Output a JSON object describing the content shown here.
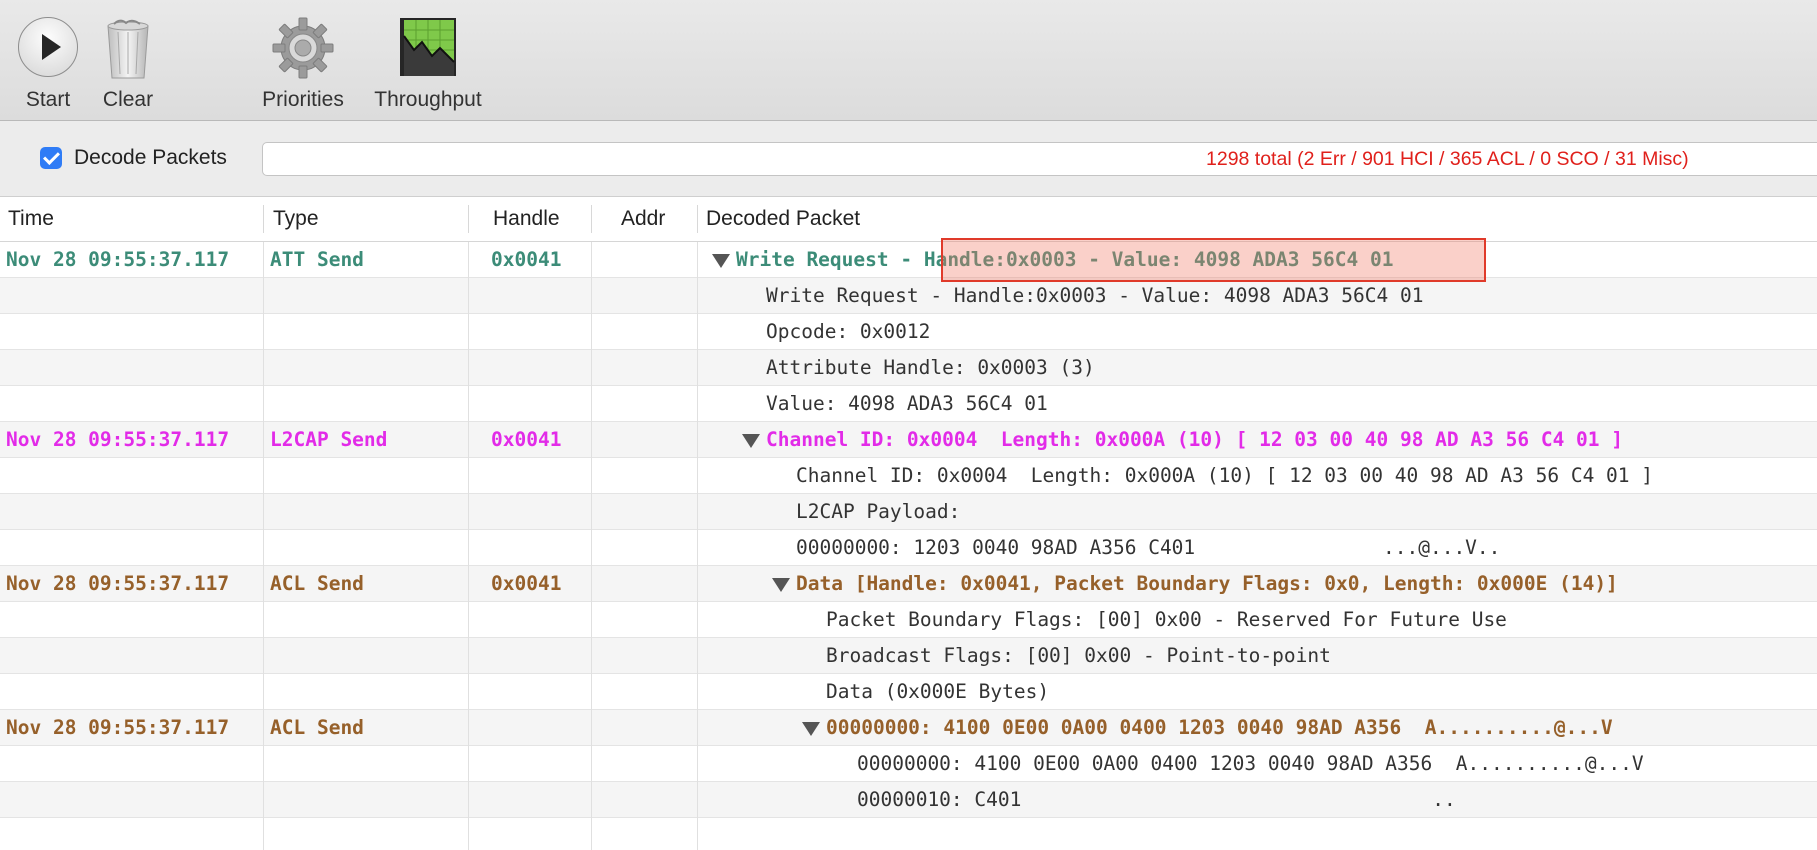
{
  "toolbar": {
    "start_label": "Start",
    "clear_label": "Clear",
    "priorities_label": "Priorities",
    "throughput_label": "Throughput"
  },
  "filter": {
    "decode_label": "Decode Packets",
    "decode_checked": true,
    "stats": "1298 total (2 Err / 901 HCI / 365 ACL / 0 SCO / 31 Misc)"
  },
  "columns": [
    "Time",
    "Type",
    "Handle",
    "Addr",
    "Decoded Packet"
  ],
  "colors": {
    "att": "#3c8c78",
    "l2cap": "#e22be8",
    "acl": "#96602a",
    "detail": "#333333",
    "highlight_border": "#e03a2a"
  },
  "rows": [
    {
      "time": "Nov 28 09:55:37.117",
      "type": "ATT Send",
      "handle": "0x0041",
      "addr": "",
      "packet": "Write Request - Handle:0x0003 - Value: 4098 ADA3 56C4 01",
      "kind": "att",
      "expandable": true
    },
    {
      "time": "",
      "type": "",
      "handle": "",
      "addr": "",
      "packet": "Write Request - Handle:0x0003 - Value: 4098 ADA3 56C4 01",
      "kind": "detail"
    },
    {
      "time": "",
      "type": "",
      "handle": "",
      "addr": "",
      "packet": "Opcode: 0x0012",
      "kind": "detail"
    },
    {
      "time": "",
      "type": "",
      "handle": "",
      "addr": "",
      "packet": "Attribute Handle: 0x0003 (3)",
      "kind": "detail"
    },
    {
      "time": "",
      "type": "",
      "handle": "",
      "addr": "",
      "packet": "Value: 4098 ADA3 56C4 01",
      "kind": "detail"
    },
    {
      "time": "Nov 28 09:55:37.117",
      "type": "L2CAP Send",
      "handle": "0x0041",
      "addr": "",
      "packet": "Channel ID: 0x0004  Length: 0x000A (10) [ 12 03 00 40 98 AD A3 56 C4 01 ]",
      "kind": "l2cap",
      "expandable": true
    },
    {
      "time": "",
      "type": "",
      "handle": "",
      "addr": "",
      "packet": "Channel ID: 0x0004  Length: 0x000A (10) [ 12 03 00 40 98 AD A3 56 C4 01 ]",
      "kind": "detail"
    },
    {
      "time": "",
      "type": "",
      "handle": "",
      "addr": "",
      "packet": "L2CAP Payload:",
      "kind": "detail"
    },
    {
      "time": "",
      "type": "",
      "handle": "",
      "addr": "",
      "packet": "00000000: 1203 0040 98AD A356 C401                ...@...V..",
      "kind": "detail"
    },
    {
      "time": "Nov 28 09:55:37.117",
      "type": "ACL Send",
      "handle": "0x0041",
      "addr": "",
      "packet": "Data [Handle: 0x0041, Packet Boundary Flags: 0x0, Length: 0x000E (14)]",
      "kind": "acl",
      "expandable": true
    },
    {
      "time": "",
      "type": "",
      "handle": "",
      "addr": "",
      "packet": "Packet Boundary Flags: [00] 0x00 - Reserved For Future Use",
      "kind": "detail"
    },
    {
      "time": "",
      "type": "",
      "handle": "",
      "addr": "",
      "packet": "Broadcast Flags: [00] 0x00 - Point-to-point",
      "kind": "detail"
    },
    {
      "time": "",
      "type": "",
      "handle": "",
      "addr": "",
      "packet": "Data (0x000E Bytes)",
      "kind": "detail"
    },
    {
      "time": "Nov 28 09:55:37.117",
      "type": "ACL Send",
      "handle": "",
      "addr": "",
      "packet": "00000000: 4100 0E00 0A00 0400 1203 0040 98AD A356  A..........@...V",
      "kind": "acl",
      "expandable": true
    },
    {
      "time": "",
      "type": "",
      "handle": "",
      "addr": "",
      "packet": "00000000: 4100 0E00 0A00 0400 1203 0040 98AD A356  A..........@...V",
      "kind": "detail"
    },
    {
      "time": "",
      "type": "",
      "handle": "",
      "addr": "",
      "packet": "00000010: C401                                   ..",
      "kind": "detail"
    },
    {
      "time": "",
      "type": "",
      "handle": "",
      "addr": "",
      "packet": "",
      "kind": "detail"
    }
  ]
}
